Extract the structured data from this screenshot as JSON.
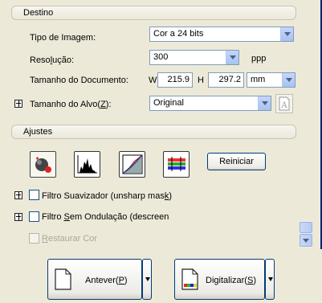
{
  "destino": {
    "header": "Destino",
    "image_type_label": "Tipo de Imagem:",
    "image_type_value": "Cor a 24 bits",
    "resolution_label_prefix": "Reso",
    "resolution_label_accel": "l",
    "resolution_label_suffix": "ução:",
    "resolution_value": "300",
    "resolution_unit": "ppp",
    "doc_size_label": "Tamanho do Documento:",
    "w_label": "W",
    "w_value": "215.9",
    "h_label": "H",
    "h_value": "297.2",
    "unit_value": "mm",
    "target_size_label_prefix": "Tamanho do Alvo(",
    "target_size_label_accel": "Z",
    "target_size_label_suffix": "):",
    "target_size_value": "Original"
  },
  "ajustes": {
    "header": "Ajustes",
    "reset_button": "Reiniciar",
    "unsharp_label_prefix": "Filtro Suavizador (unsharp mas",
    "unsharp_label_accel": "k",
    "unsharp_label_suffix": ")",
    "descreen_label_prefix": "Filtro ",
    "descreen_label_accel": "S",
    "descreen_label_suffix": "em Ondulação (descreen",
    "restore_label_prefix": "",
    "restore_label_accel": "R",
    "restore_label_suffix": "estaurar Cor"
  },
  "actions": {
    "preview_prefix": "Antever(",
    "preview_accel": "P",
    "preview_suffix": ")",
    "scan_prefix": "Digitalizar(",
    "scan_accel": "S",
    "scan_suffix": ")"
  },
  "colors": {
    "window_bg": "#ECE9D8",
    "accent_border": "#0A246A",
    "control_border": "#7F9DB9"
  }
}
